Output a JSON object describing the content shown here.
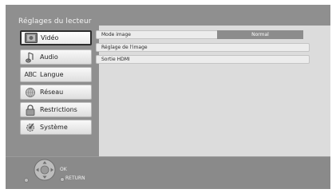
{
  "header": {
    "title": "Réglages du lecteur"
  },
  "sidebar": {
    "items": [
      {
        "label": "Vidéo",
        "icon": "video-icon",
        "selected": true
      },
      {
        "label": "Audio",
        "icon": "audio-icon",
        "selected": false
      },
      {
        "label": "Langue",
        "icon": "abc-language-icon",
        "icon_text": "ABC",
        "selected": false
      },
      {
        "label": "Réseau",
        "icon": "globe-network-icon",
        "selected": false
      },
      {
        "label": "Restrictions",
        "icon": "padlock-icon",
        "selected": false
      },
      {
        "label": "Système",
        "icon": "gear-system-icon",
        "selected": false
      }
    ]
  },
  "settings": {
    "rows": [
      {
        "label": "Mode image",
        "value": "Normal"
      },
      {
        "label": "Réglage de l'image"
      },
      {
        "label": "Sortie HDMI"
      }
    ]
  },
  "footer": {
    "ok_label": "OK",
    "return_label": "RETURN"
  },
  "colors": {
    "background": "#8f8f8f",
    "panel": "#dcdcdc",
    "value_box": "#8c8c8c",
    "selected_border": "#2c2c2c"
  }
}
